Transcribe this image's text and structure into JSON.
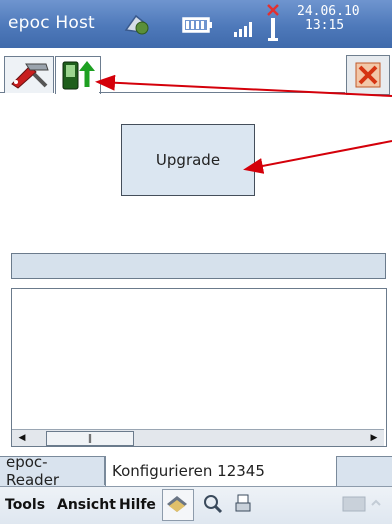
{
  "titlebar": {
    "title": "epoc Host",
    "date": "24.06.10",
    "time": "13:15",
    "icons": [
      "sync-icon",
      "battery-icon",
      "signal-icon",
      "antenna-icon"
    ]
  },
  "toolbar": {
    "icons": [
      "tools-icon",
      "device-upgrade-icon",
      "close-icon"
    ]
  },
  "main": {
    "upgrade_label": "Upgrade",
    "progress_value": "",
    "log_text": ""
  },
  "tabs": [
    {
      "label": "epoc-Reader",
      "active": false
    },
    {
      "label": "Konfigurieren 12345",
      "active": true
    }
  ],
  "menubar": {
    "items": [
      "Tools",
      "Ansicht",
      "Hilfe"
    ],
    "icons": [
      "card-icon",
      "search-icon",
      "print-icon",
      "keyboard-icon"
    ]
  },
  "colors": {
    "titlebar": "#4e79ba",
    "button_fill": "#dbe6f1",
    "annotation_arrow": "#d4000a"
  }
}
